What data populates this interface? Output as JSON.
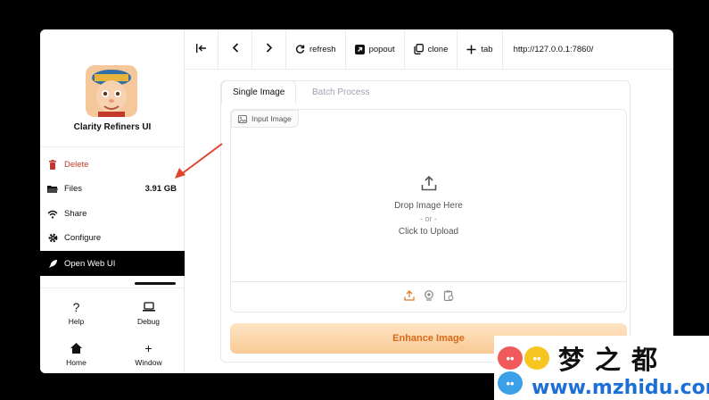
{
  "app": {
    "name": "Clarity Refiners UI"
  },
  "sidebar": {
    "items": [
      {
        "label": "Delete",
        "icon": "trash-icon"
      },
      {
        "label": "Files",
        "value": "3.91 GB",
        "icon": "folder-icon"
      },
      {
        "label": "Share",
        "icon": "wifi-icon"
      },
      {
        "label": "Configure",
        "icon": "gear-icon"
      },
      {
        "label": "Open Web UI",
        "icon": "rocket-icon"
      }
    ],
    "bottom": [
      {
        "label": "Help",
        "icon": "question-icon"
      },
      {
        "label": "Debug",
        "icon": "laptop-icon"
      },
      {
        "label": "Home",
        "icon": "home-icon"
      },
      {
        "label": "Window",
        "icon": "plus-icon"
      }
    ]
  },
  "toolbar": {
    "refresh": "refresh",
    "popout": "popout",
    "clone": "clone",
    "tab": "tab",
    "url": "http://127.0.0.1:7860/"
  },
  "main": {
    "tabs": [
      "Single Image",
      "Batch Process"
    ],
    "input_label": "Input Image",
    "drop_text": "Drop Image Here",
    "or_text": "- or -",
    "click_text": "Click to Upload",
    "enhance_button": "Enhance Image"
  },
  "watermark": {
    "title": "梦之都",
    "url": "www.mzhidu.com"
  },
  "colors": {
    "accent_orange": "#d9691a",
    "delete_red": "#c0392b",
    "active_bg": "#000000",
    "watermark_blue": "#1d6fd8"
  }
}
